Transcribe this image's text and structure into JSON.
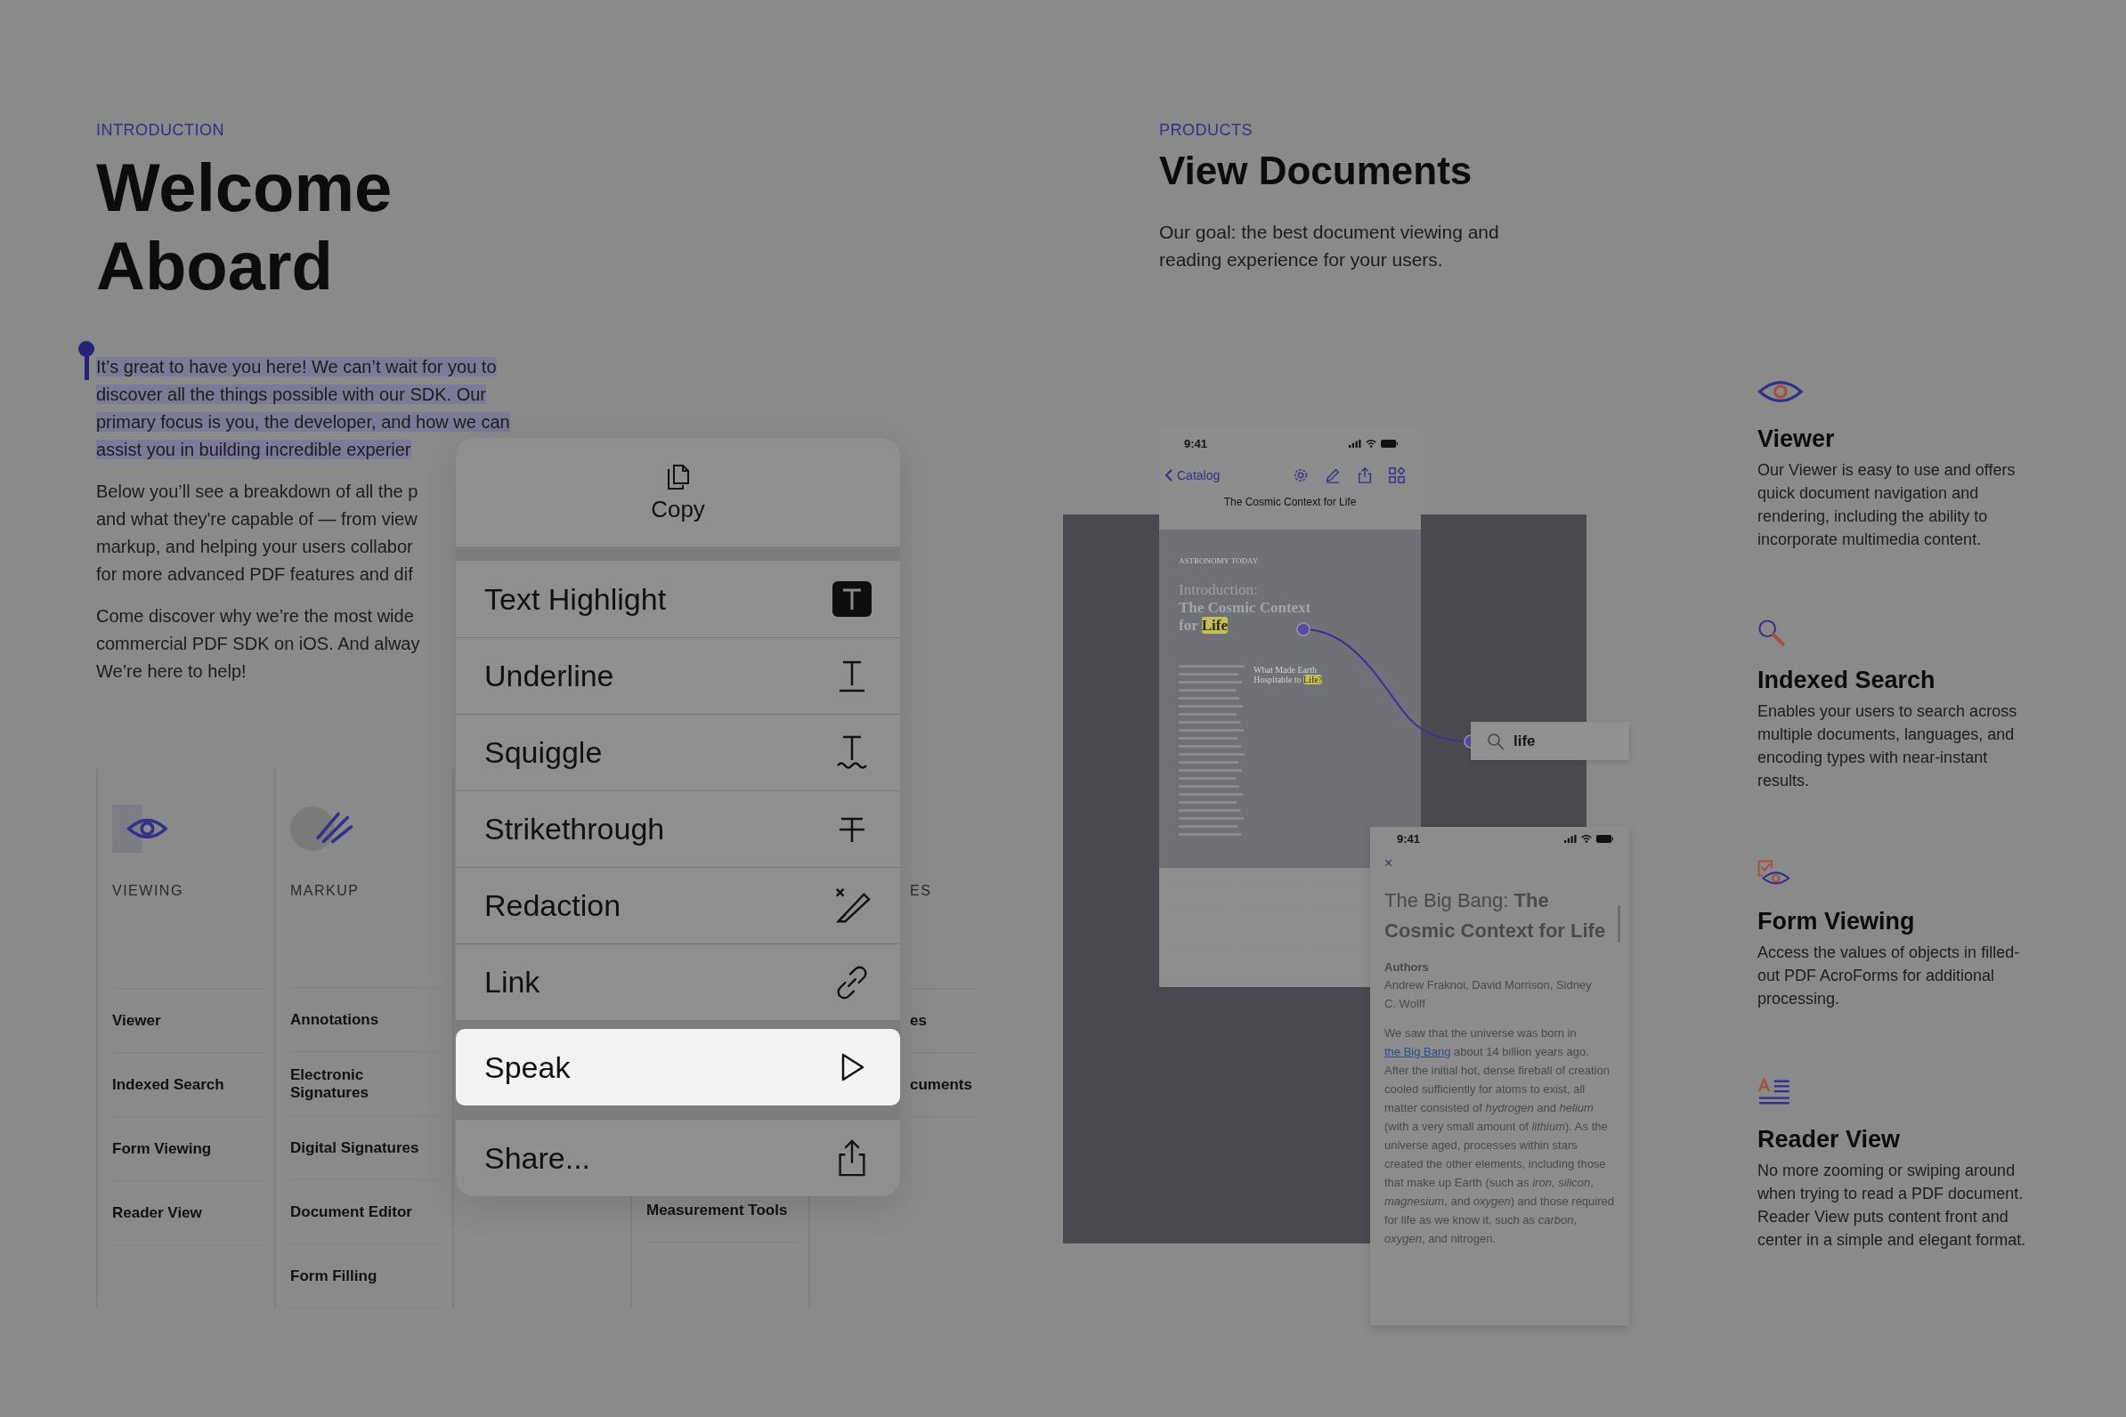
{
  "intro": {
    "eyebrow": "INTRODUCTION",
    "title": "Welcome Aboard",
    "paragraphs": [
      {
        "selected": true,
        "lines": [
          "It’s great to have you here! We can’t wait for you to",
          "discover all the things possible with our SDK. Our",
          "primary focus is you, the developer, and how we can",
          "assist you in building incredible experier"
        ]
      },
      {
        "selected": false,
        "lines": [
          "Below you’ll see a breakdown of all the p",
          "and what they're capable of — from view",
          "markup, and helping your users collabor",
          "for more advanced PDF features and dif"
        ]
      },
      {
        "selected": false,
        "lines": [
          "Come discover why we’re the most wide",
          "commercial PDF SDK on iOS. And alway",
          "We’re here to help!"
        ]
      }
    ]
  },
  "feature_columns": [
    {
      "kind": "viewing",
      "label": "VIEWING",
      "items": [
        "Viewer",
        "Indexed Search",
        "Form Viewing",
        "Reader View"
      ]
    },
    {
      "kind": "markup",
      "label": "MARKUP",
      "items": [
        "Annotations",
        "Electronic Signatures",
        "Digital Signatures",
        "Document Editor",
        "Form Filling"
      ]
    },
    {
      "kind": "covered"
    },
    {
      "kind": "covered_top",
      "items": [
        "Measurement Tools"
      ]
    },
    {
      "kind": "cut_left",
      "label": "ES",
      "items": [
        "es",
        "cuments"
      ]
    }
  ],
  "menu": {
    "copy": "Copy",
    "items": [
      {
        "kind": "highlight",
        "label": "Text Highlight",
        "selected": false
      },
      {
        "kind": "underline",
        "label": "Underline",
        "selected": false
      },
      {
        "kind": "squiggle",
        "label": "Squiggle",
        "selected": false
      },
      {
        "kind": "strikethrough",
        "label": "Strikethrough",
        "selected": false
      },
      {
        "kind": "redaction",
        "label": "Redaction",
        "selected": false
      },
      {
        "kind": "link",
        "label": "Link",
        "selected": false
      },
      {
        "kind": "speak",
        "label": "Speak",
        "selected": true
      },
      {
        "kind": "share",
        "label": "Share...",
        "selected": false
      }
    ]
  },
  "products": {
    "eyebrow": "PRODUCTS",
    "title": "View Documents",
    "text": "Our goal: the best document viewing and reading experience for your users.",
    "viewer_phone": {
      "time": "9:41",
      "back": "Catalog",
      "title": "The Cosmic Context for Life",
      "page_header": "ASTRONOMY TODAY",
      "page_intro": "Introduction:",
      "page_title": "The Cosmic Context for",
      "page_highlight": "Life",
      "section_title": "What Made Earth Hospitable to",
      "section_highlight": "Life?"
    },
    "search": {
      "value": "life"
    },
    "reader_phone": {
      "time": "9:41",
      "close": "×",
      "title": "The Big Bang: **The Cosmic Context for Life**",
      "authors_label": "Authors",
      "authors": "Andrew Fraknoi, David Morrison, Sidney C. Wolff",
      "text_before": "We saw that the universe was born in",
      "link": "the Big Bang",
      "text_after": "about 14 billion years ago. After the initial hot, dense fireball of creation cooled sufficiently for atoms to exist, all matter consisted of *hydrogen* and *helium* (with a very small amount of *lithium*). As the universe aged, processes within stars created the other elements, including those that make up Earth (such as *iron*, *silicon*, *magnesium*, and *oxygen*) and those required for life as we know it, such as *carbon*, *oxygen*, and nitrogen."
    }
  },
  "features": [
    {
      "kind": "viewer",
      "title": "Viewer",
      "text": "Our Viewer is easy to use and offers quick document navigation and rendering, including the ability to incorporate multimedia content."
    },
    {
      "kind": "search",
      "title": "Indexed Search",
      "text": "Enables your users to search across multiple documents, languages, and encoding types with near-instant results."
    },
    {
      "kind": "form",
      "title": "Form Viewing",
      "text": "Access the values of objects in filled-out PDF AcroForms for additional processing."
    },
    {
      "kind": "reader",
      "title": "Reader View",
      "text": "No more zooming or swiping around when trying to read a PDF document. Reader View puts content front and center in a simple and elegant format."
    }
  ]
}
